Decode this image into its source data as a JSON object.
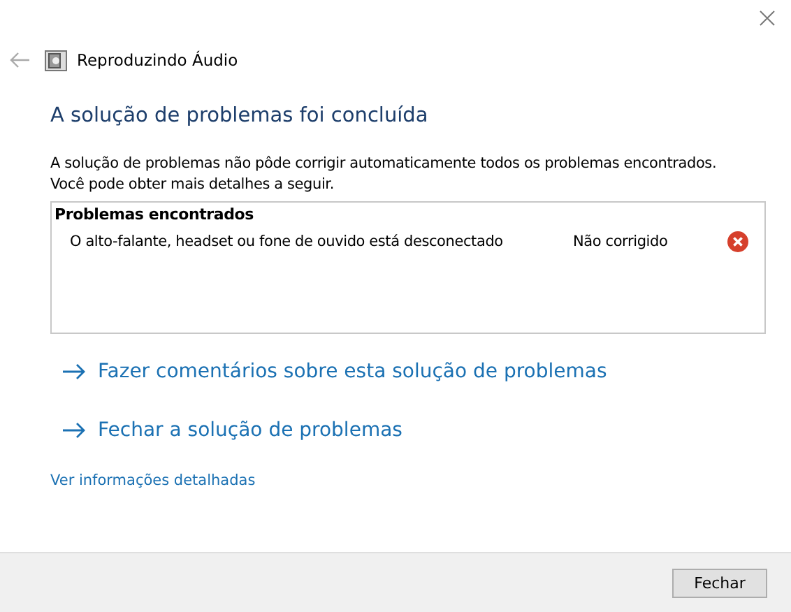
{
  "window": {
    "title": "Reproduzindo Áudio"
  },
  "heading": "A solução de problemas foi concluída",
  "description": [
    "A solução de problemas não pôde corrigir automaticamente todos os problemas encontrados.",
    "Você pode obter mais detalhes a seguir."
  ],
  "problems": {
    "title": "Problemas encontrados",
    "items": [
      {
        "name": "O alto-falante, headset ou fone de ouvido está desconectado",
        "status": "Não corrigido",
        "fixed": false
      }
    ]
  },
  "actions": [
    "Fazer comentários sobre esta solução de problemas",
    "Fechar a solução de problemas"
  ],
  "details_link": "Ver informações detalhadas",
  "buttons": [
    "Fechar"
  ]
}
